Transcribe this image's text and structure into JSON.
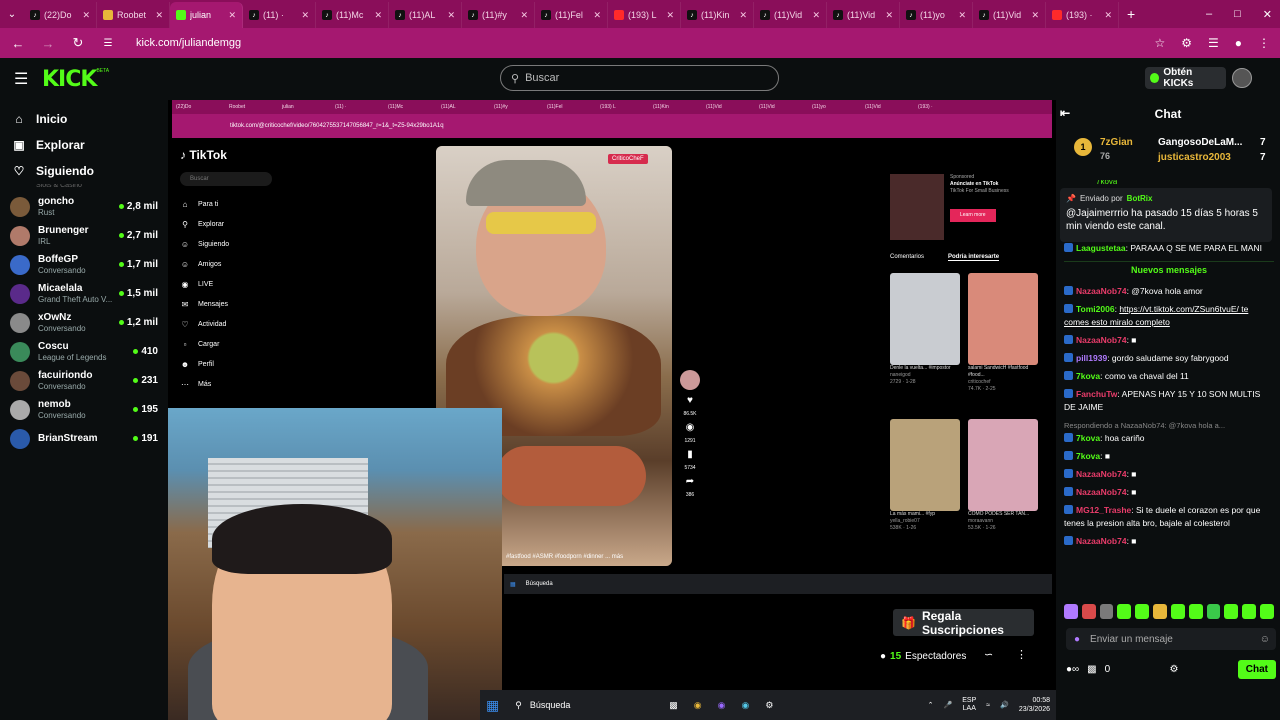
{
  "browser": {
    "tabs": [
      {
        "label": "(22)Do",
        "icon": "tiktok-icon",
        "active": false
      },
      {
        "label": "Roobet",
        "icon": "roobet-icon",
        "active": false
      },
      {
        "label": "julian",
        "icon": "kick-icon",
        "active": true
      },
      {
        "label": "(11) ·",
        "icon": "tiktok-icon",
        "active": false
      },
      {
        "label": "(11)Mc",
        "icon": "tiktok-icon",
        "active": false
      },
      {
        "label": "(11)AL",
        "icon": "tiktok-icon",
        "active": false
      },
      {
        "label": "(11)#y",
        "icon": "tiktok-icon",
        "active": false
      },
      {
        "label": "(11)Fel",
        "icon": "tiktok-icon",
        "active": false
      },
      {
        "label": "(193) L",
        "icon": "youtube-icon",
        "active": false
      },
      {
        "label": "(11)Kin",
        "icon": "tiktok-icon",
        "active": false
      },
      {
        "label": "(11)Vid",
        "icon": "tiktok-icon",
        "active": false
      },
      {
        "label": "(11)Vid",
        "icon": "tiktok-icon",
        "active": false
      },
      {
        "label": "(11)yo",
        "icon": "tiktok-icon",
        "active": false
      },
      {
        "label": "(11)Vid",
        "icon": "tiktok-icon",
        "active": false
      },
      {
        "label": "(193) ·",
        "icon": "youtube-icon",
        "active": false
      }
    ],
    "url": "kick.com/juliandemgg",
    "accent": "#a51870"
  },
  "kick": {
    "logo": "KICK",
    "beta": "BETA",
    "search_placeholder": "Buscar",
    "kicks_button": "Obtén KICKs",
    "accent": "#53fc18"
  },
  "sidebar": {
    "nav": [
      {
        "label": "Inicio",
        "icon": "home-icon"
      },
      {
        "label": "Explorar",
        "icon": "compass-icon"
      },
      {
        "label": "Siguiendo",
        "icon": "heart-icon"
      }
    ],
    "partial_top": "Slots & Casino",
    "streamers": [
      {
        "name": "goncho",
        "category": "Rust",
        "viewers": "2,8 mil",
        "color": "#7a5a3a"
      },
      {
        "name": "Brunenger",
        "category": "IRL",
        "viewers": "2,7 mil",
        "color": "#b07a6a"
      },
      {
        "name": "BoffeGP",
        "category": "Conversando",
        "viewers": "1,7 mil",
        "color": "#3a6ac9"
      },
      {
        "name": "Micaelala",
        "category": "Grand Theft Auto V...",
        "viewers": "1,5 mil",
        "color": "#5a2a8a"
      },
      {
        "name": "xOwNz",
        "category": "Conversando",
        "viewers": "1,2 mil",
        "color": "#8a8a8a"
      },
      {
        "name": "Coscu",
        "category": "League of Legends",
        "viewers": "410",
        "color": "#3a8a5a"
      },
      {
        "name": "facuiriondo",
        "category": "Conversando",
        "viewers": "231",
        "color": "#6a4a3a"
      },
      {
        "name": "nemob",
        "category": "Conversando",
        "viewers": "195",
        "color": "#aaaaaa"
      },
      {
        "name": "BrianStream",
        "category": "",
        "viewers": "191",
        "color": "#2a5aaa"
      }
    ]
  },
  "stream": {
    "inner_url": "tiktok.com/@criticochef/video/7604275537147056847_r=1&_t=Z5-94x29bo1A1q",
    "tiktok": {
      "logo": "TikTok",
      "search": "Buscar",
      "menu": [
        "Para ti",
        "Explorar",
        "Siguiendo",
        "Amigos",
        "LIVE",
        "Mensajes",
        "Actividad",
        "Cargar",
        "Perfil",
        "Más"
      ],
      "video_tag": "CriticoCheF",
      "caption": "#fastfood #ASMR #foodporn #dinner ...",
      "caption_more": "más",
      "counts": [
        "86.5K",
        "1291",
        "5734",
        "386"
      ],
      "ad_title": "Sponsored",
      "ad_text": "Anúnciate en TikTok",
      "ad_sub": "TikTok For Small Business",
      "learn_more": "Learn more",
      "tab_comments": "Comentarios",
      "tab_interesting": "Podría interesarte",
      "recs": [
        {
          "caption": "Denle la vuelta... #impostor",
          "author": "naneigod",
          "stats": "2729 · 1-28",
          "color": "#c9ccd1"
        },
        {
          "caption": "salami SandwicH #fastfood #food...",
          "author": "criticochef",
          "stats": "74.7K · 2-25",
          "color": "#d98a7a"
        },
        {
          "caption": "La más mami... #fyp",
          "author": "yella_robie07",
          "stats": "538K · 1-26",
          "color": "#b9a27a"
        },
        {
          "caption": "COMO PODES SER TAN...",
          "author": "moraavann",
          "stats": "53.5K · 1-26",
          "color": "#d9a6b6"
        }
      ]
    },
    "inner_taskbar_search": "Búsqueda",
    "regala_button": "Regala Suscripciones",
    "viewers": "15",
    "viewers_label": "Espectadores",
    "taskbar": {
      "search": "Búsqueda",
      "lang": "ESP",
      "lang2": "LAA",
      "time": "00:58",
      "date": "23/3/2026"
    }
  },
  "chat": {
    "title": "Chat",
    "gifters": [
      {
        "name": "7zGian",
        "count": "76"
      },
      {
        "name": "GangosoDeLaM...",
        "count": "7"
      },
      {
        "name": "justicastro2003",
        "count": "7"
      }
    ],
    "partial_user": "7kova",
    "pinned": {
      "sent_by_label": "Enviado por",
      "bot": "BotRix",
      "user": "@Jajaimerrrio",
      "text": "ha pasado 15 días 5 horas 5 min viendo este canal."
    },
    "messages": [
      {
        "user": "Laagustetaa",
        "color": "#53fc18",
        "text": "PARAAA Q SE ME PARA EL MANI"
      },
      {
        "sep": "Nuevos mensajes"
      },
      {
        "user": "NazaaNob74",
        "color": "#e83c6a",
        "text": "@7kova hola amor"
      },
      {
        "user": "Tomi2006",
        "color": "#53fc18",
        "text": "https://vt.tiktok.com/ZSun6tvuE/ te comes esto miralo completo",
        "link": true
      },
      {
        "user": "NazaaNob74",
        "color": "#e83c6a",
        "text": "■"
      },
      {
        "user": "pill1939",
        "color": "#b07aff",
        "text": "gordo saludame soy fabrygood"
      },
      {
        "user": "7kova",
        "color": "#53fc18",
        "text": "como va chaval del 11"
      },
      {
        "user": "FanchuTw",
        "color": "#e83c6a",
        "text": "APENAS HAY 15 Y 10 SON MULTIS DE JAIME"
      },
      {
        "reply": "Respondiendo a NazaaNob74: @7kova hola a..."
      },
      {
        "user": "7kova",
        "color": "#53fc18",
        "text": "hoa cariño"
      },
      {
        "user": "7kova",
        "color": "#53fc18",
        "text": "■"
      },
      {
        "user": "NazaaNob74",
        "color": "#e83c6a",
        "text": "■"
      },
      {
        "user": "NazaaNob74",
        "color": "#e83c6a",
        "text": "■"
      },
      {
        "user": "MG12_Trashe",
        "color": "#e83c6a",
        "text": "Si te duele el corazon es por que tenes la presion alta bro, bajale al colesterol"
      },
      {
        "user": "NazaaNob74",
        "color": "#e83c6a",
        "text": "■"
      }
    ],
    "input_placeholder": "Enviar un mensaje",
    "points": "0",
    "send_button": "Chat"
  }
}
